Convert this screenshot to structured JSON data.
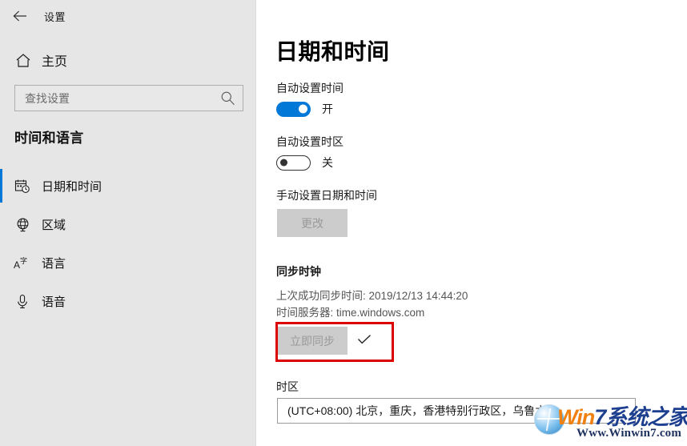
{
  "window": {
    "titlebar_text": "设置",
    "back_icon": "back-arrow-icon"
  },
  "sidebar": {
    "home": {
      "label": "主页",
      "icon": "home-icon"
    },
    "search": {
      "placeholder": "查找设置",
      "value": "",
      "icon": "search-icon"
    },
    "section_title": "时间和语言",
    "accent_color": "#0078D7",
    "background_color": "#E6E6E6",
    "items": [
      {
        "label": "日期和时间",
        "icon": "calendar-clock-icon",
        "selected": true
      },
      {
        "label": "区域",
        "icon": "globe-icon",
        "selected": false
      },
      {
        "label": "语言",
        "icon": "language-a-icon",
        "selected": false
      },
      {
        "label": "语音",
        "icon": "microphone-icon",
        "selected": false
      }
    ]
  },
  "main": {
    "page_title": "日期和时间",
    "auto_time": {
      "label": "自动设置时间",
      "state_label": "开",
      "on": true
    },
    "auto_timezone": {
      "label": "自动设置时区",
      "state_label": "关",
      "on": false
    },
    "manual": {
      "label": "手动设置日期和时间",
      "button_label": "更改",
      "button_disabled": true
    },
    "sync": {
      "heading": "同步时钟",
      "last_sync_line": "上次成功同步时间: 2019/12/13 14:44:20",
      "server_line": "时间服务器: time.windows.com",
      "button_label": "立即同步",
      "button_disabled": true,
      "status_icon": "checkmark-icon",
      "highlight_color": "#DD0000"
    },
    "timezone": {
      "label": "时区",
      "selected_value": "(UTC+08:00) 北京，重庆，香港特别行政区，乌鲁木齐"
    }
  },
  "watermark": {
    "logo_icon": "windows-orb-icon",
    "text_win": "Win",
    "text_seven": "7",
    "text_cn": "系统之家",
    "url": "Www.Winwin7.com"
  }
}
